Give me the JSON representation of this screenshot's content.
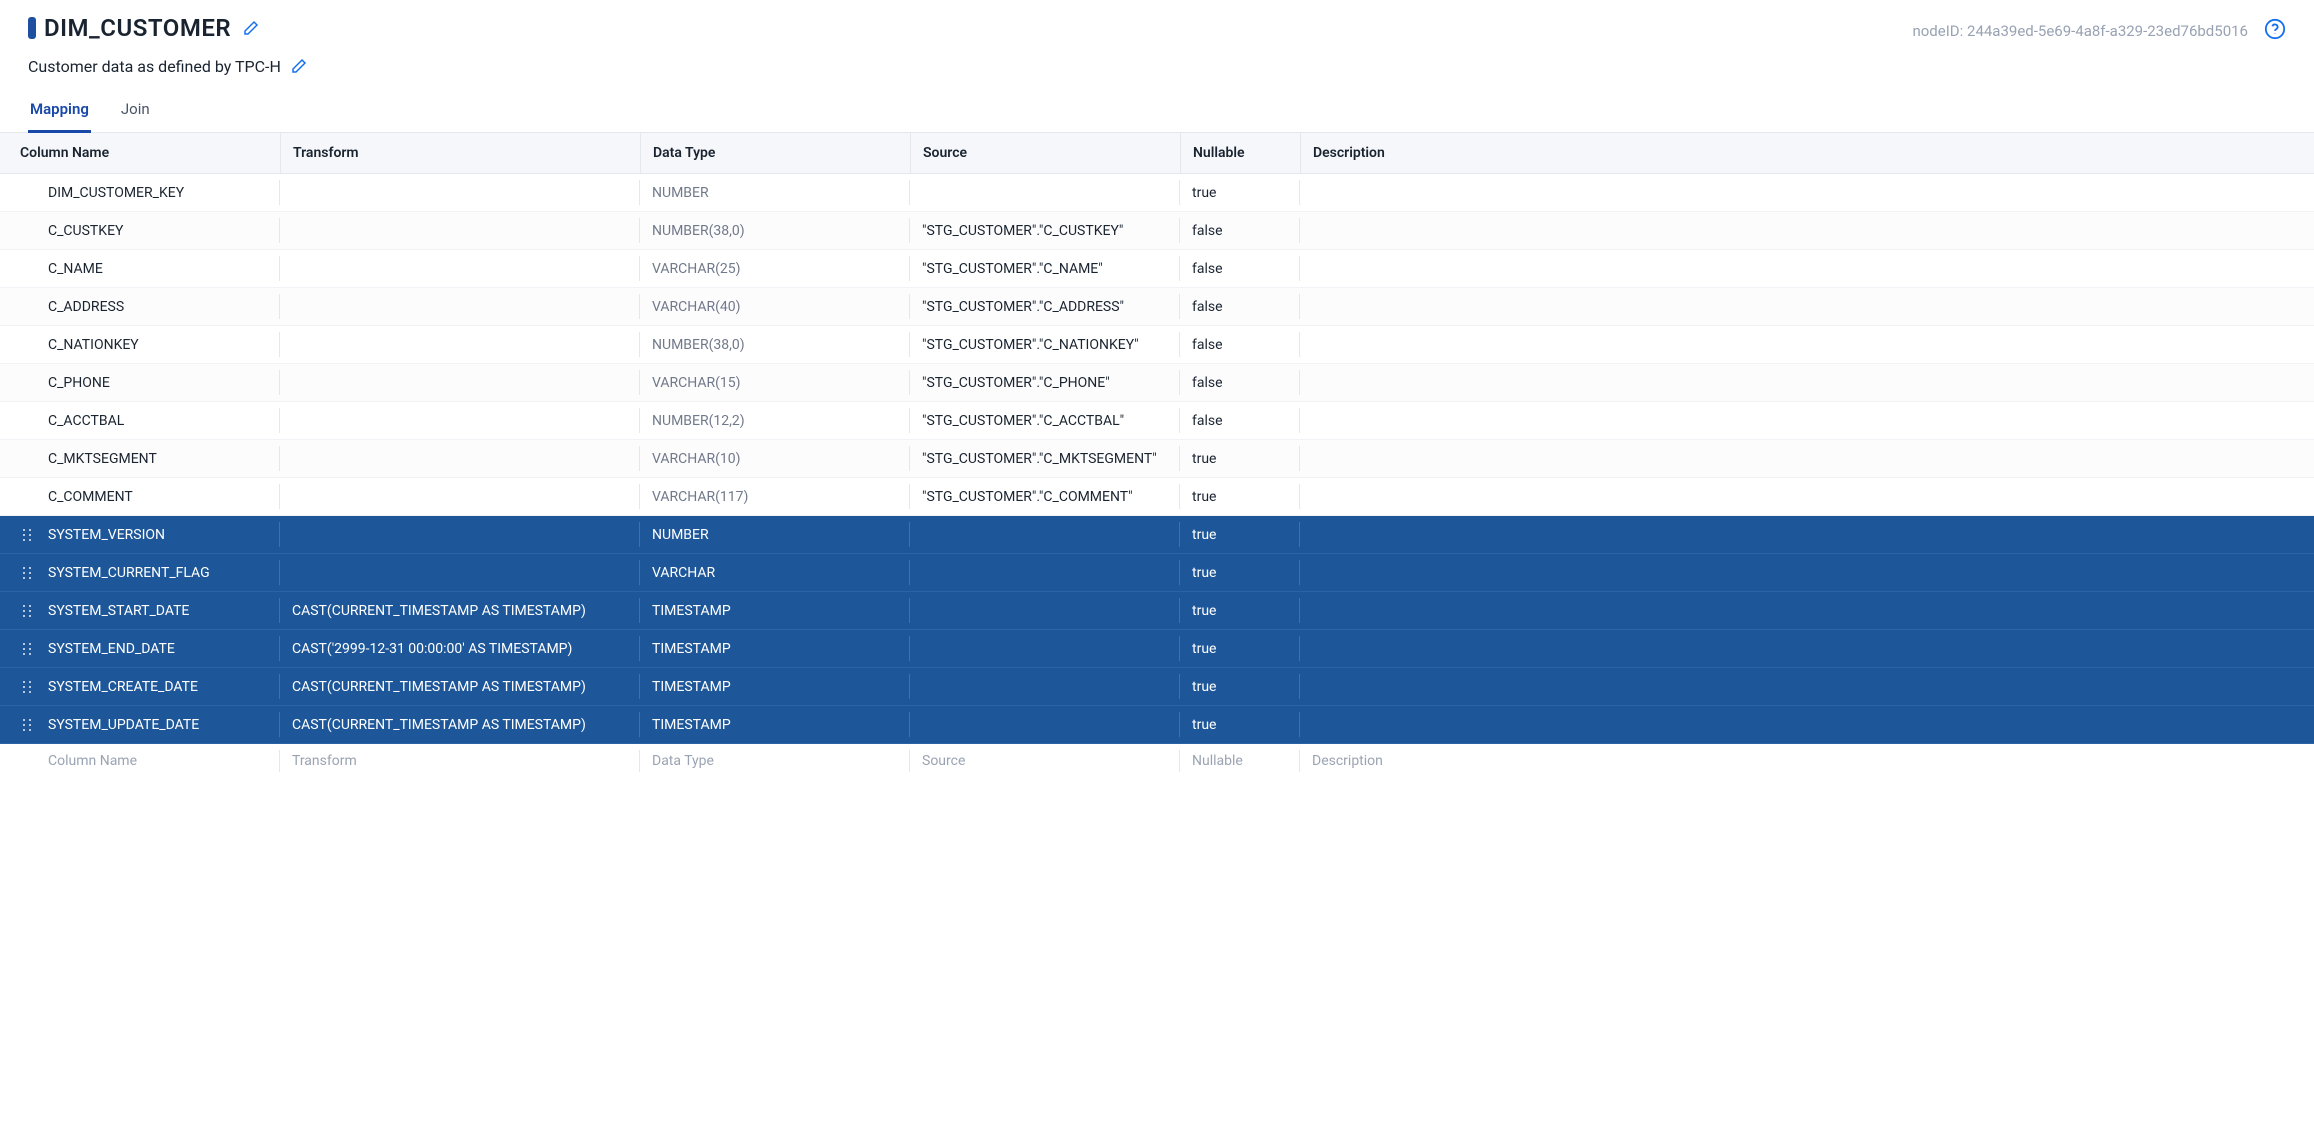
{
  "header": {
    "title": "DIM_CUSTOMER",
    "subtitle": "Customer data as defined by TPC-H",
    "nodeid_label": "nodeID:",
    "nodeid_value": "244a39ed-5e69-4a8f-a329-23ed76bd5016"
  },
  "tabs": [
    {
      "label": "Mapping",
      "active": true
    },
    {
      "label": "Join",
      "active": false
    }
  ],
  "columns": [
    {
      "label": "Column Name"
    },
    {
      "label": "Transform"
    },
    {
      "label": "Data Type"
    },
    {
      "label": "Source"
    },
    {
      "label": "Nullable"
    },
    {
      "label": "Description"
    }
  ],
  "rows": [
    {
      "name": "DIM_CUSTOMER_KEY",
      "transform": "",
      "datatype": "NUMBER",
      "source": "",
      "nullable": "true",
      "description": "",
      "selected": false
    },
    {
      "name": "C_CUSTKEY",
      "transform": "",
      "datatype": "NUMBER(38,0)",
      "source": "\"STG_CUSTOMER\".\"C_CUSTKEY\"",
      "nullable": "false",
      "description": "",
      "selected": false
    },
    {
      "name": "C_NAME",
      "transform": "",
      "datatype": "VARCHAR(25)",
      "source": "\"STG_CUSTOMER\".\"C_NAME\"",
      "nullable": "false",
      "description": "",
      "selected": false
    },
    {
      "name": "C_ADDRESS",
      "transform": "",
      "datatype": "VARCHAR(40)",
      "source": "\"STG_CUSTOMER\".\"C_ADDRESS\"",
      "nullable": "false",
      "description": "",
      "selected": false
    },
    {
      "name": "C_NATIONKEY",
      "transform": "",
      "datatype": "NUMBER(38,0)",
      "source": "\"STG_CUSTOMER\".\"C_NATIONKEY\"",
      "nullable": "false",
      "description": "",
      "selected": false
    },
    {
      "name": "C_PHONE",
      "transform": "",
      "datatype": "VARCHAR(15)",
      "source": "\"STG_CUSTOMER\".\"C_PHONE\"",
      "nullable": "false",
      "description": "",
      "selected": false
    },
    {
      "name": "C_ACCTBAL",
      "transform": "",
      "datatype": "NUMBER(12,2)",
      "source": "\"STG_CUSTOMER\".\"C_ACCTBAL\"",
      "nullable": "false",
      "description": "",
      "selected": false
    },
    {
      "name": "C_MKTSEGMENT",
      "transform": "",
      "datatype": "VARCHAR(10)",
      "source": "\"STG_CUSTOMER\".\"C_MKTSEGMENT\"",
      "nullable": "true",
      "description": "",
      "selected": false
    },
    {
      "name": "C_COMMENT",
      "transform": "",
      "datatype": "VARCHAR(117)",
      "source": "\"STG_CUSTOMER\".\"C_COMMENT\"",
      "nullable": "true",
      "description": "",
      "selected": false
    },
    {
      "name": "SYSTEM_VERSION",
      "transform": "",
      "datatype": "NUMBER",
      "source": "",
      "nullable": "true",
      "description": "",
      "selected": true
    },
    {
      "name": "SYSTEM_CURRENT_FLAG",
      "transform": "",
      "datatype": "VARCHAR",
      "source": "",
      "nullable": "true",
      "description": "",
      "selected": true
    },
    {
      "name": "SYSTEM_START_DATE",
      "transform": "CAST(CURRENT_TIMESTAMP AS TIMESTAMP)",
      "datatype": "TIMESTAMP",
      "source": "",
      "nullable": "true",
      "description": "",
      "selected": true
    },
    {
      "name": "SYSTEM_END_DATE",
      "transform": "CAST('2999-12-31 00:00:00' AS TIMESTAMP)",
      "datatype": "TIMESTAMP",
      "source": "",
      "nullable": "true",
      "description": "",
      "selected": true
    },
    {
      "name": "SYSTEM_CREATE_DATE",
      "transform": "CAST(CURRENT_TIMESTAMP AS TIMESTAMP)",
      "datatype": "TIMESTAMP",
      "source": "",
      "nullable": "true",
      "description": "",
      "selected": true
    },
    {
      "name": "SYSTEM_UPDATE_DATE",
      "transform": "CAST(CURRENT_TIMESTAMP AS TIMESTAMP)",
      "datatype": "TIMESTAMP",
      "source": "",
      "nullable": "true",
      "description": "",
      "selected": true
    }
  ],
  "footer_placeholders": {
    "name": "Column Name",
    "transform": "Transform",
    "datatype": "Data Type",
    "source": "Source",
    "nullable": "Nullable",
    "description": "Description"
  }
}
